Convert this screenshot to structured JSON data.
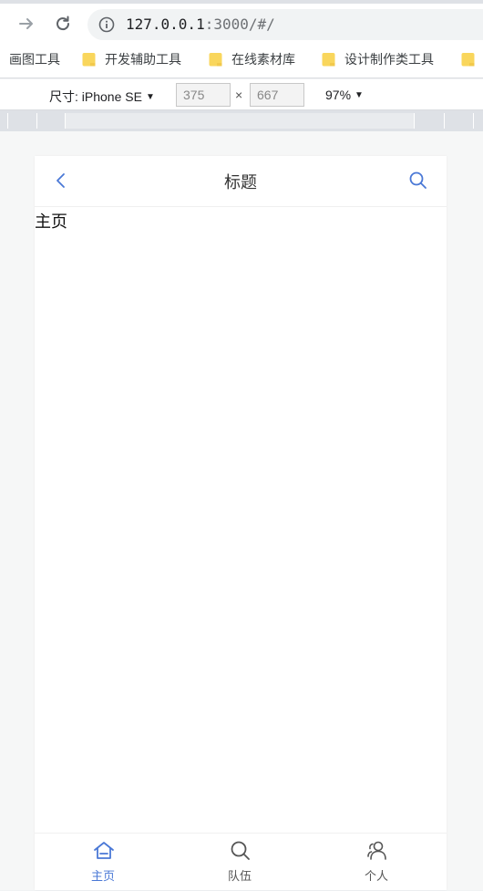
{
  "browser": {
    "url_host": "127.0.0.1",
    "url_rest": ":3000/#/",
    "bookmarks": [
      "画图工具",
      "开发辅助工具",
      "在线素材库",
      "设计制作类工具"
    ]
  },
  "devtools": {
    "device_label": "尺寸: iPhone SE",
    "width": "375",
    "times": "×",
    "height": "667",
    "zoom": "97%"
  },
  "app": {
    "header_title": "标题",
    "page_text": "主页",
    "tabs": [
      {
        "label": "主页",
        "icon": "home-icon",
        "active": true
      },
      {
        "label": "队伍",
        "icon": "search-icon",
        "active": false
      },
      {
        "label": "个人",
        "icon": "users-icon",
        "active": false
      }
    ]
  },
  "colors": {
    "accent": "#4a78d6",
    "folder": "#f9d65c"
  }
}
